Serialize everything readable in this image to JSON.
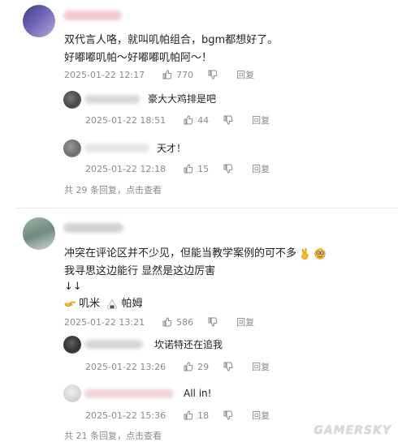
{
  "comment1": {
    "line1": "双代言人咯，就叫叽帕组合，bgm都想好了。",
    "line2": "好嘟嘟叽帕～好嘟嘟叽帕阿～！",
    "date": "2025-01-22 12:17",
    "likes": "770",
    "reply_label": "回复",
    "replies": [
      {
        "text": "豪大大鸡排是吧",
        "date": "2025-01-22 18:51",
        "likes": "44",
        "reply_label": "回复"
      },
      {
        "text": "天才！",
        "date": "2025-01-22 12:18",
        "likes": "15",
        "reply_label": "回复"
      }
    ],
    "footer": "共 29 条回复，点击查看"
  },
  "comment2": {
    "line1": "冲突在评论区并不少见，但能当教学案例的可不多",
    "line2": "我寻思这边能行 显然是这边厉害",
    "line3": "↓↓",
    "tag1": "叽米",
    "tag2": "帕姆",
    "date": "2025-01-22 13:21",
    "likes": "586",
    "reply_label": "回复",
    "replies": [
      {
        "text": "坎诺特还在追我",
        "date": "2025-01-22 13:26",
        "likes": "29",
        "reply_label": "回复"
      },
      {
        "text": "All in!",
        "date": "2025-01-22 15:36",
        "likes": "18",
        "reply_label": "回复"
      }
    ],
    "footer": "共 21 条回复，点击查看"
  },
  "watermark": "GAMERSKY",
  "colors": {
    "meta": "#8a8a8a",
    "text": "#222222",
    "divider": "#ececec"
  },
  "icons": {
    "like": "thumbs-up-icon",
    "dislike": "thumbs-down-icon"
  }
}
